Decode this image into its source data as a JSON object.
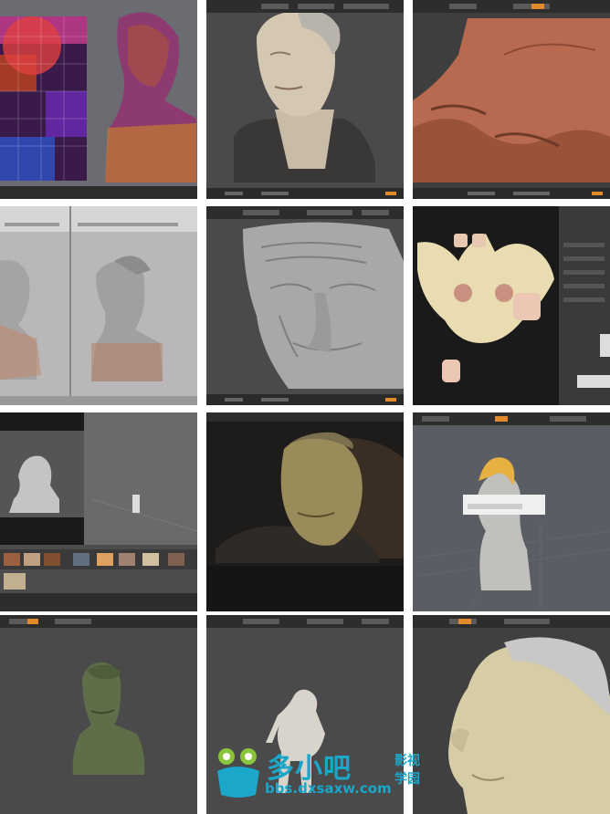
{
  "gallery": {
    "tiles": [
      {
        "id": "t1",
        "subject": "uv-texture-bust"
      },
      {
        "id": "t2",
        "subject": "old-man-bust-render"
      },
      {
        "id": "t3",
        "subject": "skin-closeup-sculpt"
      },
      {
        "id": "t4",
        "subject": "dual-viewport-busts"
      },
      {
        "id": "t5",
        "subject": "wrinkled-face-closeup"
      },
      {
        "id": "t6",
        "subject": "uv-skin-map"
      },
      {
        "id": "t7",
        "subject": "reference-photo-scene"
      },
      {
        "id": "t8",
        "subject": "lit-render-bust"
      },
      {
        "id": "t9",
        "subject": "hair-sculpt-dialog"
      },
      {
        "id": "t10",
        "subject": "green-bust-sculpt"
      },
      {
        "id": "t11",
        "subject": "creature-figure-sculpt"
      },
      {
        "id": "t12",
        "subject": "elderly-profile-sculpt"
      }
    ]
  },
  "watermark": {
    "logo_text": "多小吧",
    "sub_text": "影视学园",
    "url": "bbs.dxsaxw.com"
  },
  "colors": {
    "ui_dark": "#2d2d2d",
    "viewport_gray": "#4a4a4a",
    "accent_orange": "#e08a2c",
    "watermark_cyan": "#1aa7c9"
  }
}
